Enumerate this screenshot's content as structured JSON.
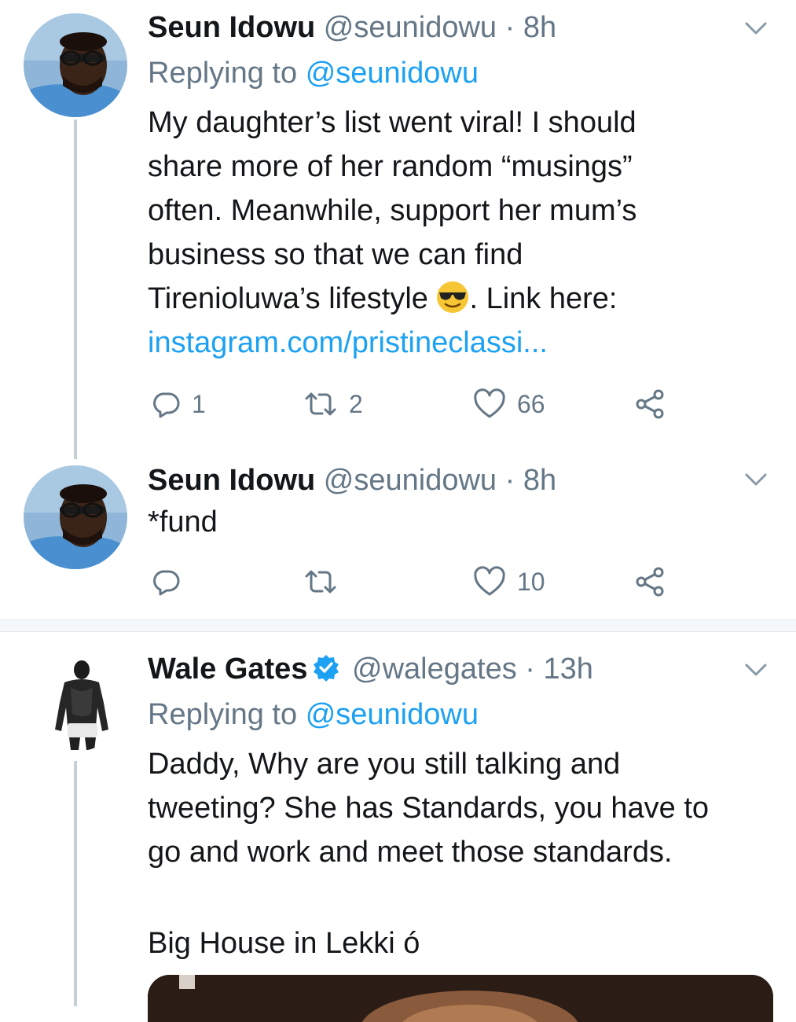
{
  "tweets": [
    {
      "name": "Seun Idowu",
      "handle": "@seunidowu",
      "separator": "·",
      "time": "8h",
      "replying_label": "Replying to",
      "replying_to": "@seunidowu",
      "text_lines": [
        "My daughter’s list went viral! I should",
        "share more of her random “musings”",
        "often. Meanwhile, support her mum’s",
        "business so that we can find",
        "Tirenioluwa’s lifestyle",
        ". Link here:"
      ],
      "emoji": "smiling-face-with-sunglasses",
      "link": "instagram.com/pristineclassi...",
      "replies": "1",
      "retweets": "2",
      "likes": "66"
    },
    {
      "name": "Seun Idowu",
      "handle": "@seunidowu",
      "separator": "·",
      "time": "8h",
      "text": "*fund",
      "replies": "",
      "retweets": "",
      "likes": "10"
    },
    {
      "name": "Wale Gates",
      "verified": true,
      "handle": "@walegates",
      "separator": "·",
      "time": "13h",
      "replying_label": "Replying to",
      "replying_to": "@seunidowu",
      "text_lines": [
        "Daddy, Why are you still talking and",
        "tweeting? She has Standards, you have to",
        "go and work and meet those standards."
      ],
      "text_line_2": "Big House in Lekki ó"
    }
  ],
  "icons": {
    "reply": "reply-icon",
    "retweet": "retweet-icon",
    "like": "heart-icon",
    "share": "share-icon",
    "menu": "chevron-down-icon",
    "verified": "verified-badge-icon"
  },
  "colors": {
    "link": "#1da1f2",
    "secondary_text": "#657786",
    "primary_text": "#14171a",
    "thread_line": "#c4cfd6",
    "verified": "#1da1f2"
  }
}
